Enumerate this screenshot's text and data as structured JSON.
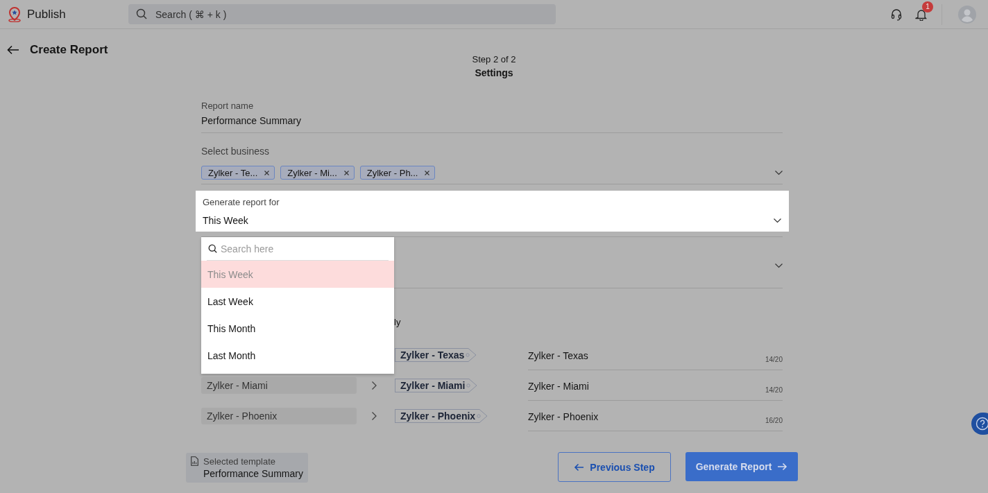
{
  "app": {
    "name": "Publish"
  },
  "search": {
    "placeholder": "Search ( ⌘ + k )"
  },
  "notifications": {
    "badge": "1"
  },
  "page": {
    "title": "Create Report"
  },
  "step": {
    "text": "Step 2 of 2",
    "title": "Settings"
  },
  "report_name": {
    "label": "Report name",
    "value": "Performance Summary"
  },
  "select_business": {
    "label": "Select business",
    "chips": [
      "Zylker - Te...",
      "Zylker - Mi...",
      "Zylker - Ph..."
    ]
  },
  "generate_for": {
    "label": "Generate report for",
    "value": "This Week",
    "dropdown": {
      "placeholder": "Search here",
      "options": [
        {
          "label": "This Week",
          "selected": true
        },
        {
          "label": "Last Week",
          "selected": false
        },
        {
          "label": "This Month",
          "selected": false
        },
        {
          "label": "Last Month",
          "selected": false
        }
      ]
    }
  },
  "hidden_text_fragment": "ly",
  "mappings": [
    {
      "target": "Zylker - Texas",
      "name": "Zylker - Texas",
      "count": "14/20"
    },
    {
      "source": "Zylker - Miami",
      "target": "Zylker - Miami",
      "name": "Zylker - Miami",
      "count": "14/20"
    },
    {
      "source": "Zylker - Phoenix",
      "target": "Zylker - Phoenix",
      "name": "Zylker - Phoenix",
      "count": "16/20"
    }
  ],
  "selected_template": {
    "label": "Selected template",
    "value": "Performance Summary"
  },
  "buttons": {
    "previous": "Previous Step",
    "generate": "Generate Report"
  }
}
